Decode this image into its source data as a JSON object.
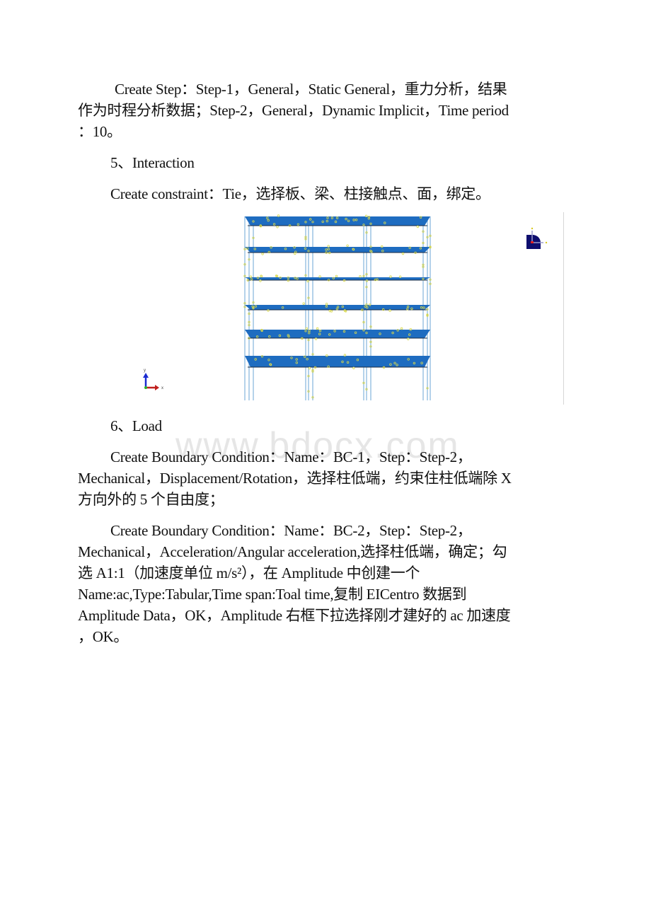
{
  "watermark": "www.bdocx.com",
  "paragraphs": {
    "step": {
      "lines": [
        "Create Step：Step-1，General，Static General，重力分析，结果",
        "作为时程分析数据；Step-2，General，Dynamic Implicit，Time period",
        "：10。"
      ]
    },
    "interaction_heading": "5、Interaction",
    "constraint": "Create constraint：Tie，选择板、梁、柱接触点、面，绑定。",
    "load_heading": "6、Load",
    "bc1": {
      "lines": [
        "Create Boundary Condition：Name：BC-1，Step：Step-2，",
        "Mechanical，Displacement/Rotation，选择柱低端，约束住柱低端除 X",
        "方向外的 5 个自由度；"
      ]
    },
    "bc2": {
      "lines": [
        "Create Boundary Condition：Name：BC-2，Step：Step-2，",
        "Mechanical，Acceleration/Angular acceleration,选择柱低端，确定；勾",
        "选 A1:1（加速度单位 m/s²），在 Amplitude 中创建一个",
        "Name:ac,Type:Tabular,Time span:Toal time,复制 EICentro 数据到",
        "Amplitude Data，OK，Amplitude 右框下拉选择刚才建好的 ac 加速度",
        "，OK。"
      ]
    }
  },
  "figure": {
    "description": "Abaqus frame model view: 6 floor slabs with columns, tie constraint markers",
    "floors": 6,
    "slab_color": "#1e6cc0",
    "column_color": "#6fa6d6",
    "marker_color": "#d8d84a",
    "triad": {
      "x_label": "x",
      "y_label": "y"
    },
    "view_cube_labels": {
      "top": "z",
      "right": "x"
    }
  }
}
